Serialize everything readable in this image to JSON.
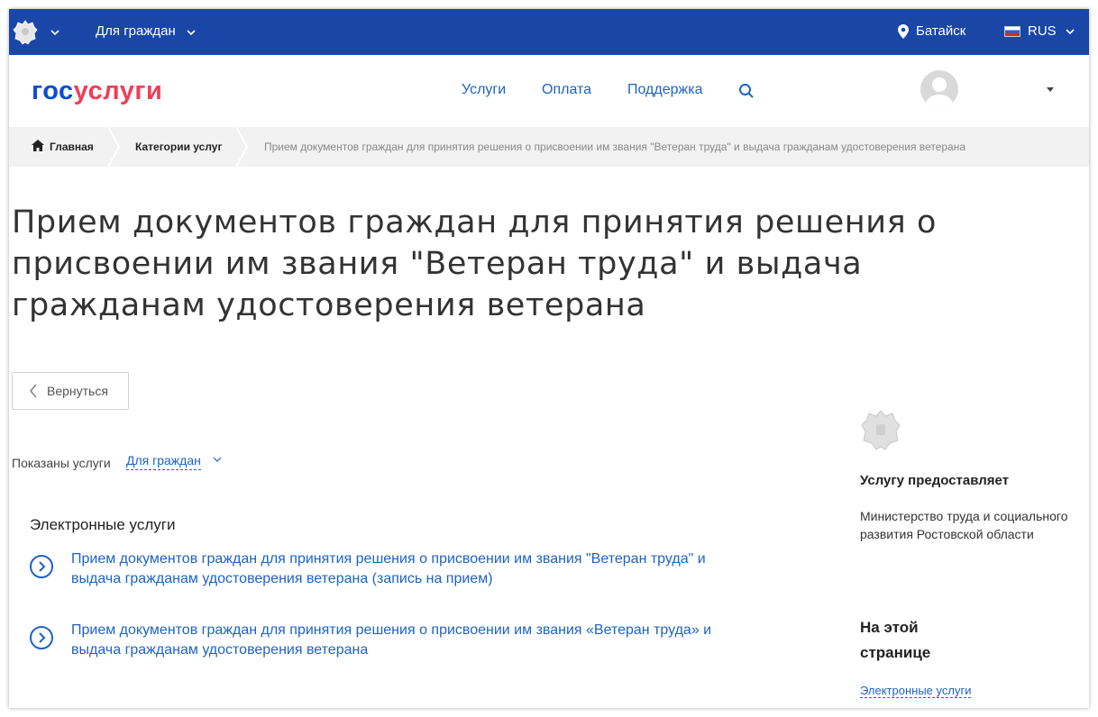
{
  "topbar": {
    "audience": "Для граждан",
    "city": "Батайск",
    "language": "RUS"
  },
  "header": {
    "logo_gos": "гос",
    "logo_uslugi": "услуги",
    "nav": [
      "Услуги",
      "Оплата",
      "Поддержка"
    ]
  },
  "breadcrumbs": {
    "home": "Главная",
    "categories": "Категории услуг",
    "current": "Прием документов граждан для принятия решения о присвоении им звания \"Ветеран труда\" и выдача гражданам удостоверения ветерана"
  },
  "page": {
    "title_line1": "Прием документов граждан для принятия решения о",
    "title_line2": "присвоении им звания \"Ветеран труда\" и выдача",
    "title_line3": "гражданам удостоверения ветерана",
    "back_label": "Вернуться",
    "filter_label": "Показаны услуги",
    "filter_value": "Для граждан",
    "section_title": "Электронные услуги",
    "services": [
      {
        "line1": "Прием документов граждан для принятия решения о присвоении им звания \"Ветеран труда\" и",
        "line2": "выдача гражданам удостоверения ветерана (запись на прием)"
      },
      {
        "line1": "Прием документов граждан для принятия решения о присвоении им звания «Ветеран труда» и",
        "line2": "выдача гражданам удостоверения ветерана"
      }
    ]
  },
  "sidebar": {
    "provider_heading": "Услугу предоставляет",
    "provider_name": "Министерство труда и социального развития Ростовской области",
    "on_page_line1": "На этой",
    "on_page_line2": "странице",
    "on_page_link": "Электронные услуги"
  },
  "colors": {
    "topbar_bg": "#1a46a8",
    "link": "#1e63c4",
    "logo_blue": "#0d4cd3",
    "logo_red": "#ee3f58"
  }
}
